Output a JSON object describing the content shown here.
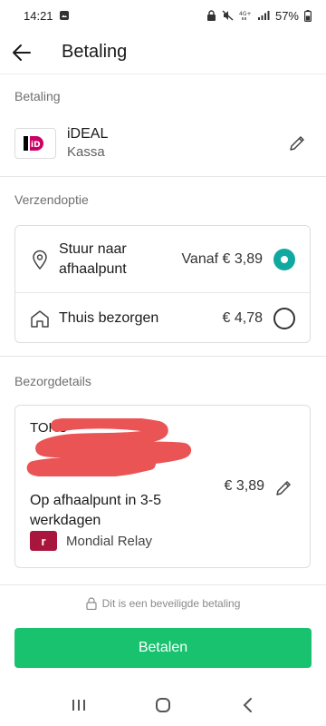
{
  "status_bar": {
    "time": "14:21",
    "battery": "57%"
  },
  "header": {
    "title": "Betaling"
  },
  "payment": {
    "section_label": "Betaling",
    "method_name": "iDEAL",
    "method_sub": "Kassa",
    "logo_text": "iD"
  },
  "shipping": {
    "section_label": "Verzendoptie",
    "options": [
      {
        "label_line1": "Stuur naar",
        "label_line2": "afhaalpunt",
        "price": "Vanaf € 3,89",
        "selected": true,
        "icon": "location-pin-icon"
      },
      {
        "label_line1": "Thuis bezorgen",
        "price": "€ 4,78",
        "selected": false,
        "icon": "home-icon"
      }
    ]
  },
  "details": {
    "section_label": "Bezorgdetails",
    "seller_prefix": "TOKO",
    "eta": "Op afhaalpunt in 3-5 werkdagen",
    "price": "€ 3,89",
    "carrier_name": "Mondial Relay",
    "carrier_logo_glyph": "r"
  },
  "footer": {
    "secure_text": "Dit is een beveiligde betaling",
    "pay_button": "Betalen"
  },
  "colors": {
    "accent_teal": "#10a9a0",
    "pay_green": "#18c26e",
    "carrier_red": "#a8163e",
    "redaction": "#ea5455"
  }
}
